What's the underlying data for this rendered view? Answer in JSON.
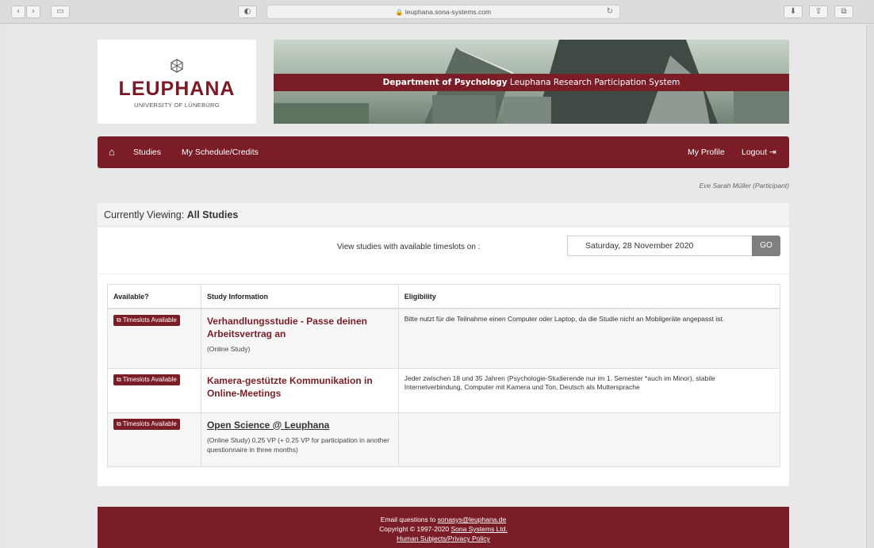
{
  "browser": {
    "url": "leuphana.sona-systems.com",
    "nav_back": "‹",
    "nav_forward": "›"
  },
  "logo": {
    "name": "LEUPHANA",
    "subtitle": "UNIVERSITY OF LÜNEBURG"
  },
  "banner": {
    "department": "Department of Psychology",
    "system": "Leuphana Research Participation System"
  },
  "nav": {
    "studies": "Studies",
    "schedule": "My Schedule/Credits",
    "profile": "My Profile",
    "logout": "Logout"
  },
  "user": "Eve Sarah Müller (Participant)",
  "viewing": {
    "prefix": "Currently Viewing:",
    "value": "All Studies"
  },
  "filter": {
    "label": "View studies with available timeslots on :",
    "date": "Saturday, 28 November 2020",
    "go": "GO"
  },
  "table": {
    "headers": [
      "Available?",
      "Study Information",
      "Eligibility"
    ],
    "rows": [
      {
        "button": "Timeslots Available",
        "title": "Verhandlungsstudie - Passe deinen Arbeitsvertrag an",
        "meta": "(Online Study)",
        "eligibility": "Bitte nutzt für die Teilnahme einen Computer oder Laptop, da die Studie nicht an Mobilgeräte angepasst ist."
      },
      {
        "button": "Timeslots Available",
        "title": "Kamera-gestützte Kommunikation in Online-Meetings",
        "meta": "",
        "eligibility": "Jeder zwischen 18 und 35 Jahren (Psychologie-Studierende nur im 1. Semester *auch im Minor), stabile Internetverbindung, Computer mit Kamera und Ton, Deutsch als Muttersprache"
      },
      {
        "button": "Timeslots Available",
        "title": "Open Science @ Leuphana",
        "meta": "(Online Study) 0.25 VP (+ 0.25 VP for participation in another questionnaire in three months)",
        "eligibility": ""
      }
    ]
  },
  "footer": {
    "email_prefix": "Email questions to",
    "email": "sonasys@leuphana.de",
    "copyright_prefix": "Copyright © 1997-2020",
    "company": "Sona Systems Ltd.",
    "privacy": "Human Subjects/Privacy Policy"
  },
  "colors": {
    "brand": "#7a1d26",
    "go_button": "#7f7f7f"
  }
}
